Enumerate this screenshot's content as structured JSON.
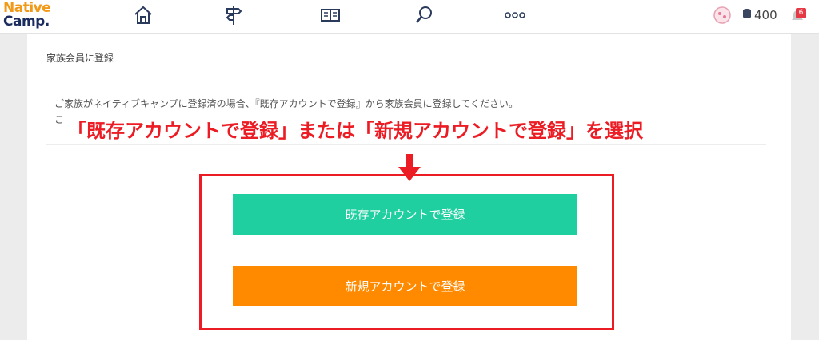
{
  "header": {
    "logo_line1": "Native",
    "logo_line2": "Camp.",
    "coin_count": "400",
    "notification_count": "6",
    "nav_icons": [
      "home-icon",
      "signpost-icon",
      "book-icon",
      "search-icon",
      "more-icon"
    ]
  },
  "card": {
    "title": "家族会員に登録",
    "description": "ご家族がネイティブキャンプに登録済の場合、『既存アカウントで登録』から家族会員に登録してください。",
    "description_line2_partial": "こ"
  },
  "annotation": {
    "text": "「既存アカウントで登録」または「新規アカウントで登録」を選択"
  },
  "buttons": {
    "existing_label": "既存アカウントで登録",
    "new_label": "新規アカウントで登録"
  },
  "colors": {
    "existing_button": "#1fcfa0",
    "new_button": "#ff8a00",
    "annotation_red": "#ec1c24",
    "logo_orange": "#f29a17",
    "logo_navy": "#1a2b5e"
  }
}
